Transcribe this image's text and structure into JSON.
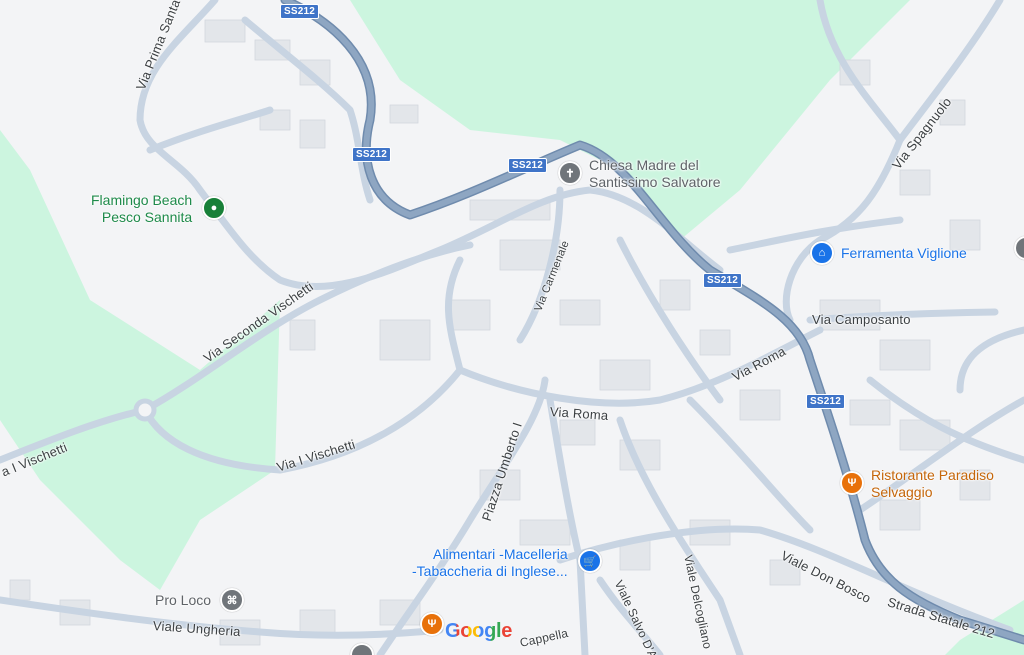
{
  "map": {
    "streets": [
      {
        "id": "via-prima-santa",
        "text": "Via Prima Santa"
      },
      {
        "id": "via-spagnuolo",
        "text": "Via Spagnuolo"
      },
      {
        "id": "via-carmenale",
        "text": "Via Carmenale"
      },
      {
        "id": "via-seconda-vischetti",
        "text": "Via Seconda Vischetti"
      },
      {
        "id": "via-camposanto",
        "text": "Via Camposanto"
      },
      {
        "id": "via-roma-east",
        "text": "Via Roma"
      },
      {
        "id": "via-roma-center",
        "text": "Via Roma"
      },
      {
        "id": "via-i-vischetti-west",
        "text": "a I Vischetti"
      },
      {
        "id": "via-i-vischetti",
        "text": "Via I Vischetti"
      },
      {
        "id": "piazza-umberto",
        "text": "Piazza Umberto I"
      },
      {
        "id": "viale-don-bosco",
        "text": "Viale Don Bosco"
      },
      {
        "id": "strada-statale",
        "text": "Strada Statale 212"
      },
      {
        "id": "viale-delcogliano",
        "text": "Viale Delcogliano"
      },
      {
        "id": "viale-salvo",
        "text": "Viale Salvo D'A"
      },
      {
        "id": "viale-ungheria",
        "text": "Viale Ungheria"
      },
      {
        "id": "cappella",
        "text": "Cappella"
      }
    ],
    "shields": [
      {
        "id": "ss212-top",
        "text": "SS212"
      },
      {
        "id": "ss212-left",
        "text": "SS212"
      },
      {
        "id": "ss212-mid",
        "text": "SS212"
      },
      {
        "id": "ss212-right",
        "text": "SS212"
      },
      {
        "id": "ss212-lower",
        "text": "SS212"
      }
    ],
    "pois": [
      {
        "id": "chiesa",
        "line1": "Chiesa Madre del",
        "line2": "Santissimo Salvatore",
        "icon": "cross-icon",
        "color": "#70757a"
      },
      {
        "id": "flamingo",
        "line1": "Flamingo Beach",
        "line2": "Pesco Sannita",
        "icon": "park-icon",
        "color": "#188038"
      },
      {
        "id": "ferramenta",
        "line1": "Ferramenta Viglione",
        "line2": "",
        "icon": "shop-icon",
        "color": "#1a73e8"
      },
      {
        "id": "ristorante",
        "line1": "Ristorante Paradiso",
        "line2": "Selvaggio",
        "icon": "restaurant-icon",
        "color": "#e8710a"
      },
      {
        "id": "alimentari",
        "line1": "Alimentari -Macelleria",
        "line2": "-Tabaccheria di Inglese...",
        "icon": "shopping-cart-icon",
        "color": "#1a73e8"
      },
      {
        "id": "proloco",
        "line1": "Pro Loco",
        "line2": "",
        "icon": "landmark-icon",
        "color": "#70757a"
      }
    ],
    "logo": {
      "text": "Google"
    },
    "colors": {
      "background": "#f3f4f6",
      "green_area": "#ccf5df",
      "highway": "#8ea6c2",
      "street": "#c8d4e2",
      "shield": "#3f74c8"
    }
  }
}
